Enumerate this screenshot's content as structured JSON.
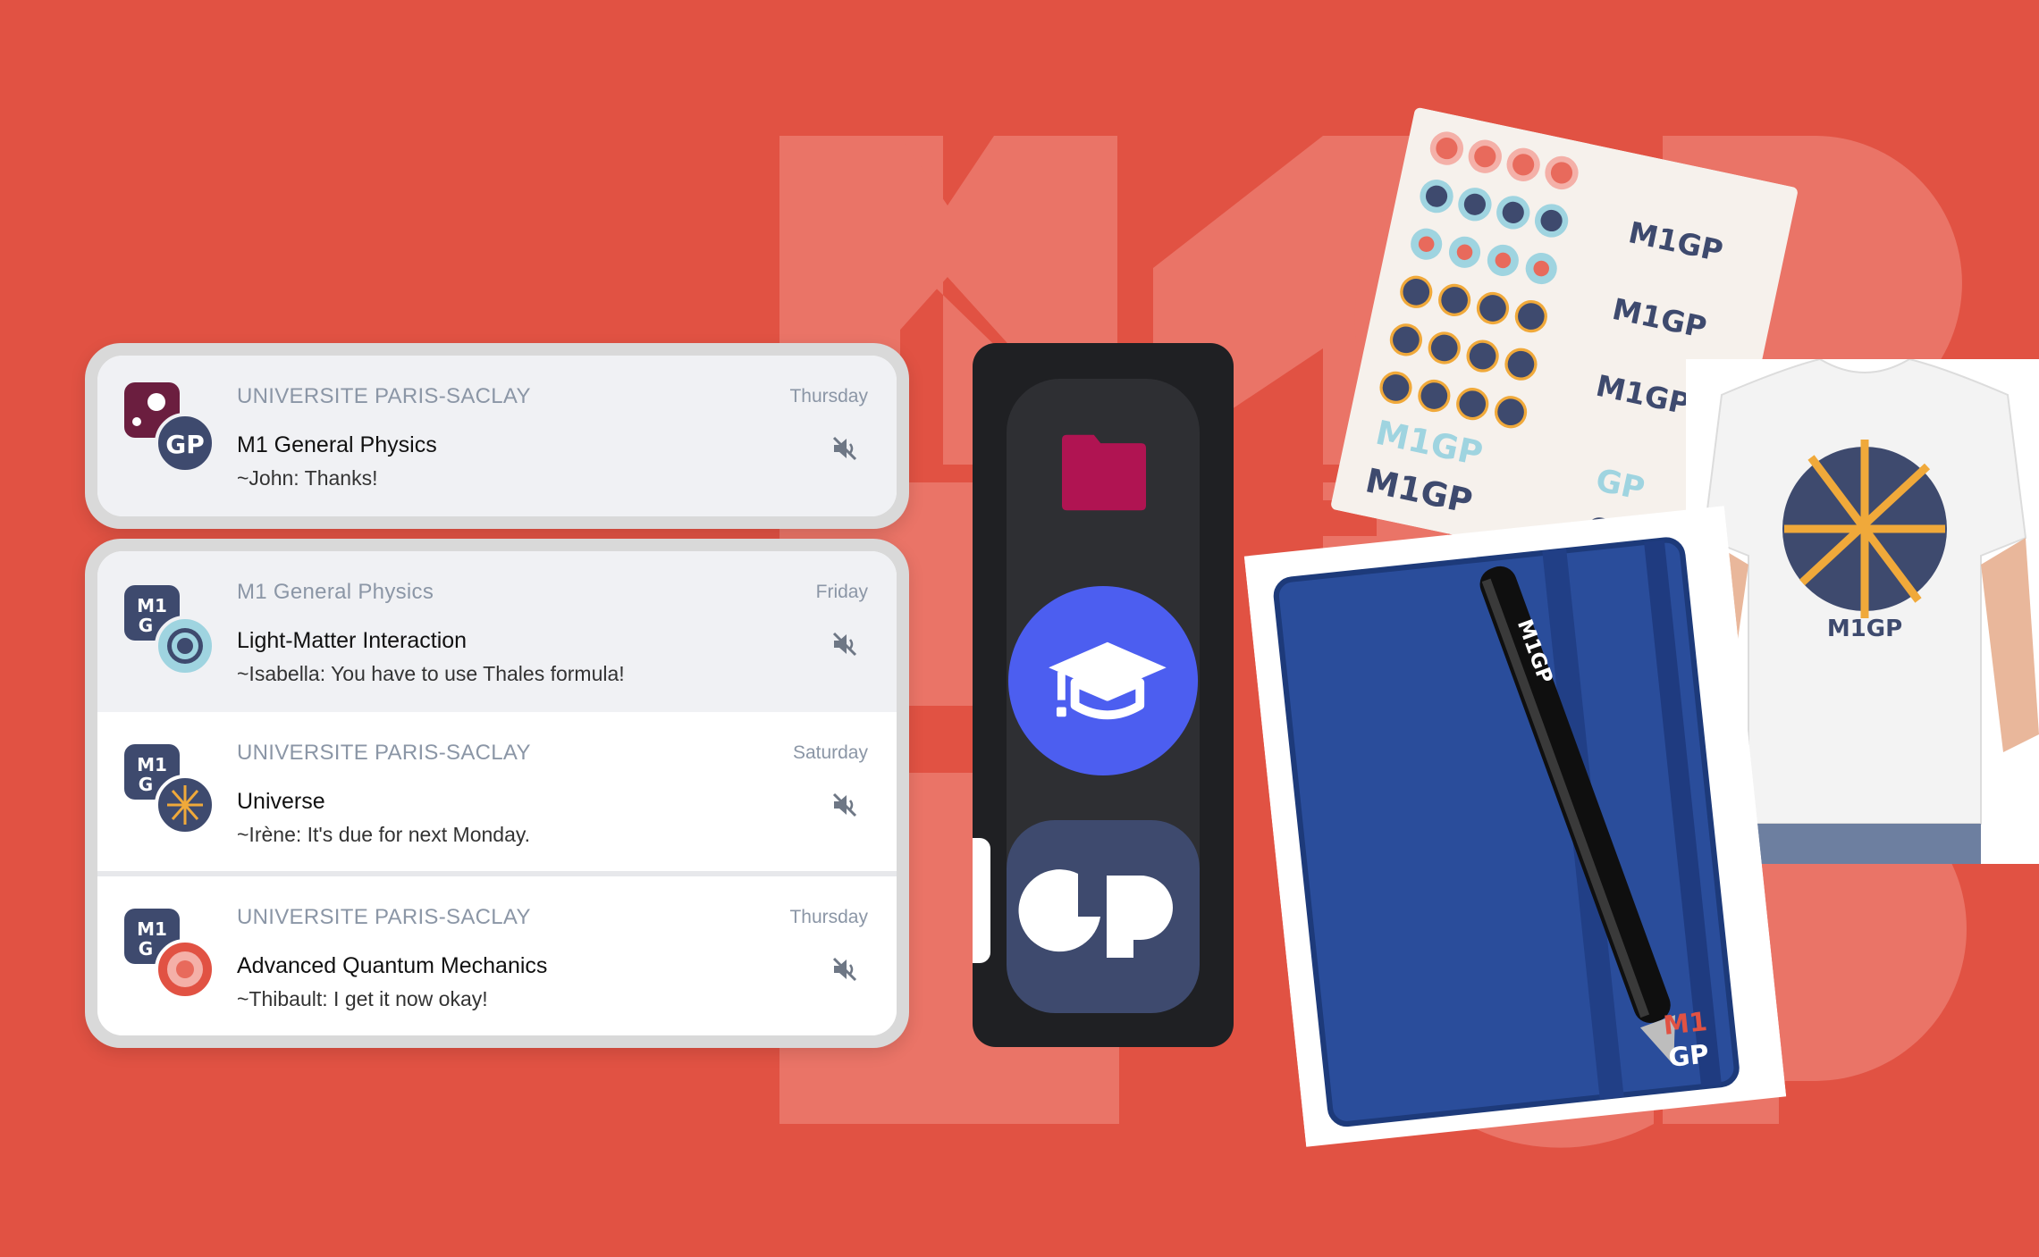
{
  "colors": {
    "background": "#e15243",
    "accent_blue": "#4c5ef0",
    "folder_magenta": "#b01452",
    "gp_tile": "#3e4a6e",
    "muted_text": "#8b96a6"
  },
  "notifications": {
    "group1": [
      {
        "group": "UNIVERSITE PARIS-SACLAY",
        "date": "Thursday",
        "title": "M1 General Physics",
        "message": "~John: Thanks!",
        "avatar_icon": "m1gp-community-icon",
        "muted_icon": "mute-icon"
      }
    ],
    "group2": [
      {
        "group": "M1 General Physics",
        "date": "Friday",
        "title": "Light-Matter Interaction",
        "message": "~Isabella: You have to use Thales formula!",
        "avatar_icon": "target-course-icon",
        "muted_icon": "mute-icon"
      },
      {
        "group": "UNIVERSITE PARIS-SACLAY",
        "date": "Saturday",
        "title": "Universe",
        "message": "~Irène: It's due for next Monday.",
        "avatar_icon": "starburst-course-icon",
        "muted_icon": "mute-icon"
      },
      {
        "group": "UNIVERSITE PARIS-SACLAY",
        "date": "Thursday",
        "title": "Advanced Quantum Mechanics",
        "message": "~Thibault: I get it now okay!",
        "avatar_icon": "red-dot-course-icon",
        "muted_icon": "mute-icon"
      }
    ]
  },
  "sidebar": {
    "items": [
      {
        "icon": "folder-icon"
      },
      {
        "icon": "graduation-cap-icon"
      },
      {
        "icon": "gp-logo-icon"
      }
    ]
  },
  "merch": {
    "sticker_logo": "M1GP",
    "shirt_logo": "M1GP",
    "pen_logo": "M1GP",
    "notebook_logo_top": "M1",
    "notebook_logo_bottom": "GP",
    "sticker_small_gp": "GP"
  },
  "background_letters": "M1GP"
}
